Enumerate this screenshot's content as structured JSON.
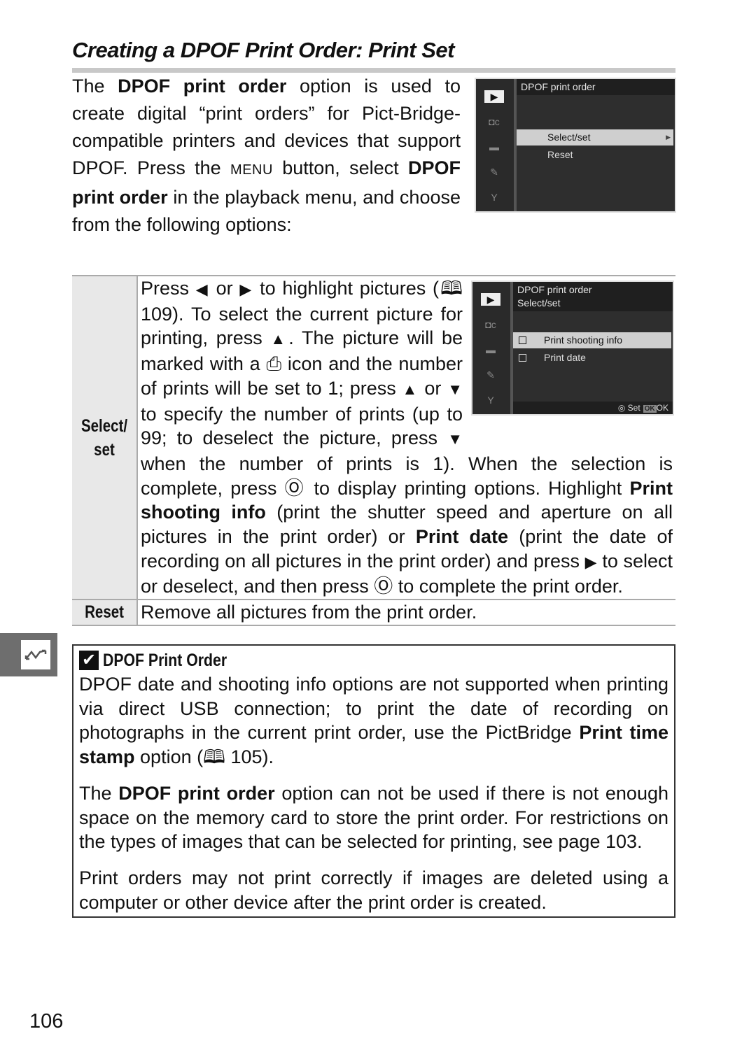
{
  "page": {
    "title": "Creating a DPOF Print Order: Print Set",
    "page_number": "106"
  },
  "intro": {
    "t1": "The ",
    "b1": "DPOF print order",
    "t2": " option is used to create digital “print orders” for Pict-Bridge-compatible printers and devices that support DPOF.  Press the ",
    "menu_key": "MENU",
    "t3": " button, select ",
    "b2": "DPOF print order",
    "t4": " in the playback menu, and choose from the following options:"
  },
  "screen1": {
    "header": "DPOF print order",
    "items": [
      {
        "label": "Select/set",
        "highlighted": true,
        "has_arrow": true
      },
      {
        "label": "Reset",
        "highlighted": false
      }
    ],
    "side_icons": [
      "playback-icon",
      "camera-custom-icon",
      "movie-icon",
      "retouch-icon",
      "setup-wrench-icon"
    ]
  },
  "screen2": {
    "header_line1": "DPOF print order",
    "header_line2": "Select/set",
    "items": [
      {
        "label": "Print shooting info",
        "highlighted": true,
        "checked": false
      },
      {
        "label": "Print date",
        "highlighted": false,
        "checked": false
      }
    ],
    "footer_set": "Set",
    "footer_ok_badge": "OK",
    "footer_ok": "OK"
  },
  "options_table": {
    "rows": [
      {
        "header": "Select/ set",
        "segments": {
          "s1": "Press ",
          "left": "◀",
          "s2": " or ",
          "right": "▶",
          "s3": " to highlight pictures (",
          "book": "🕮",
          "s4": " 109).  To select the current picture for printing, press ",
          "up1": "▲",
          "s5": ". The picture will be marked with a ",
          "print_icon": "⎙",
          "s6": " icon and the number of prints will be set to 1; press ",
          "up2": "▲",
          "s7": " or ",
          "down1": "▼",
          "s8": " to specify the number of prints (up to 99; to deselect the picture, press ",
          "down2": "▼",
          "s9": " when the number of prints is 1).  When the selection is complete, press ",
          "ok1": "Ⓞ",
          "s10": " to display printing options.  Highlight ",
          "b1": "Print shooting info",
          "s11": " (print the shutter speed and aperture on all pictures in the print order) or ",
          "b2": "Print date",
          "s12": " (print the date of recording on all pictures in the print order) and press ",
          "right2": "▶",
          "s13": " to select or deselect, and then press ",
          "ok2": "Ⓞ",
          "s14": " to complete the print order."
        }
      },
      {
        "header": "Reset",
        "text": "Remove all pictures from the print order."
      }
    ]
  },
  "side_tab": {
    "icon": "playback-tab-icon"
  },
  "note": {
    "title": "DPOF Print Order",
    "p1_a": "DPOF date and shooting info options are not supported when printing via direct USB connection; to print the date of recording on photographs in the current print order, use the PictBridge ",
    "p1_b": "Print time stamp",
    "p1_c": " option (",
    "p1_book": "🕮",
    "p1_d": " 105).",
    "p2_a": "The ",
    "p2_b": "DPOF print order",
    "p2_c": " option can not be used if there is not enough space on the memory card to store the print order.  For restrictions on the types of images that can be selected for printing, see page 103.",
    "p3": "Print orders may not print correctly if images are deleted using a computer or other device after the print order is created."
  }
}
